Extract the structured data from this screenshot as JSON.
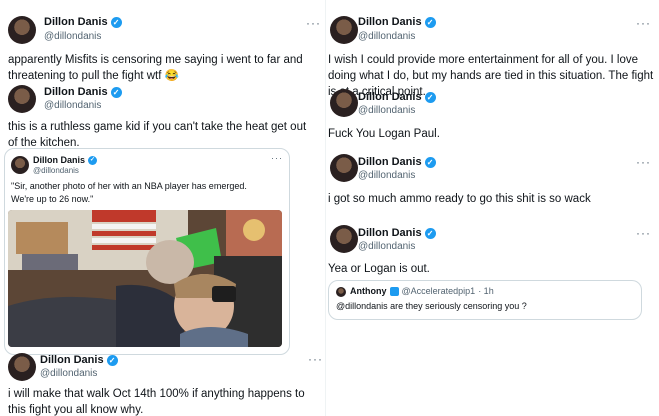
{
  "posts": {
    "p1": {
      "name": "Dillon Danis",
      "handle": "@dillondanis",
      "menu": "···",
      "text": "apparently Misfits is censoring me saying i went to far and threatening to pull the fight wtf 😂"
    },
    "p2": {
      "name": "Dillon Danis",
      "handle": "@dillondanis",
      "text": "this is a ruthless game kid if you can't take the heat get out of the kitchen."
    },
    "p2_quote": {
      "name": "Dillon Danis",
      "handle": "@dillondanis",
      "menu": "···",
      "text": "\"Sir, another photo of her with an NBA player has emerged. We're up to 26 now.\""
    },
    "p3": {
      "name": "Dillon Danis",
      "handle": "@dillondanis",
      "menu": "···",
      "text": "i will make that walk Oct 14th 100% if anything happens to this fight you all know why."
    },
    "p4": {
      "name": "Dillon Danis",
      "handle": "@dillondanis",
      "menu": "···",
      "text": "I wish I could provide more entertainment for all of you. I love doing what I do, but my hands are tied in this situation. The fight is at a critical point."
    },
    "p5": {
      "name": "Dillon Danis",
      "handle": "@dillondanis",
      "text": "Fuck You Logan Paul."
    },
    "p6": {
      "name": "Dillon Danis",
      "handle": "@dillondanis",
      "menu": "···",
      "text": "i got so much ammo ready to go this shit is so wack"
    },
    "p7": {
      "name": "Dillon Danis",
      "handle": "@dillondanis",
      "menu": "···",
      "text": "Yea or Logan is out."
    },
    "p7_quote": {
      "name": "Anthony",
      "handle": "@Acceleratedpip1",
      "time": "· 1h",
      "text": "@dillondanis are they seriously censoring you ?"
    }
  },
  "badge_glyph": "✓",
  "colors": {
    "verified": "#1d9bf0",
    "muted": "#536471",
    "border": "#cfd9de"
  }
}
